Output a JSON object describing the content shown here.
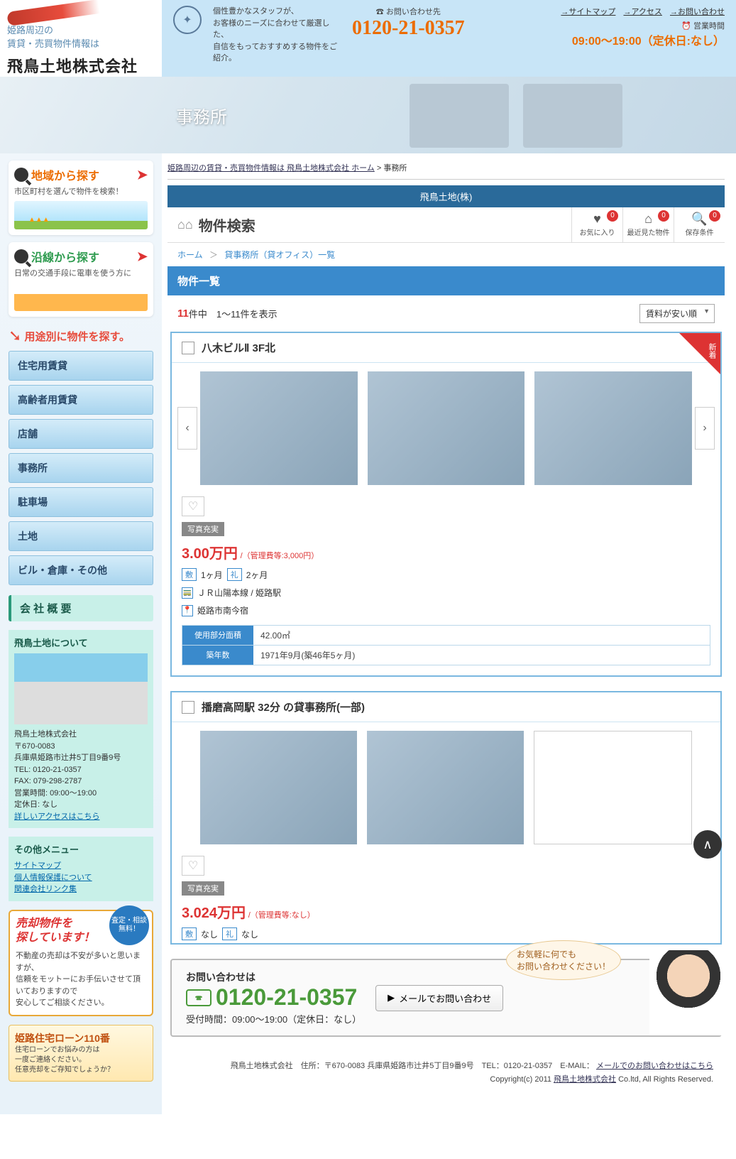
{
  "header": {
    "tagline1": "姫路周辺の",
    "tagline2": "賃貸・売買物件情報は",
    "company": "飛鳥土地株式会社",
    "msg": "個性豊かなスタッフが、\nお客様のニーズに合わせて厳選した、\n自信をもっておすすめする物件をご紹介。",
    "phone_label": "☎ お問い合わせ先",
    "phone": "0120-21-0357",
    "links": {
      "sitemap": "→サイトマップ",
      "access": "→アクセス",
      "contact": "→お問い合わせ"
    },
    "hours_label": "⏰ 営業時間",
    "hours": "09:00～19:00（定休日:なし）"
  },
  "hero": {
    "title": "事務所"
  },
  "sidebar": {
    "search_area": {
      "title": "地域から探す",
      "sub": "市区町村を選んで物件を検索！"
    },
    "search_line": {
      "title": "沿線から探す",
      "sub": "日常の交通手段に電車を使う方に"
    },
    "cat_heading": "用途別に物件を探す。",
    "categories": [
      "住宅用賃貸",
      "高齢者用賃貸",
      "店舗",
      "事務所",
      "駐車場",
      "土地",
      "ビル・倉庫・その他"
    ],
    "company_panel": "会 社 概 要",
    "about": {
      "title": "飛鳥土地について",
      "name": "飛鳥土地株式会社",
      "zip": "〒670-0083",
      "addr": "兵庫県姫路市辻井5丁目9番9号",
      "tel": "TEL: 0120-21-0357",
      "fax": "FAX: 079-298-2787",
      "hours": "営業時間: 09:00～19:00",
      "holiday": "定休日: なし",
      "access_link": "詳しいアクセスはこちら"
    },
    "other_menu": {
      "title": "その他メニュー",
      "items": [
        "サイトマップ",
        "個人情報保護について",
        "関連会社リンク集"
      ]
    },
    "sell_banner": {
      "badge": "査定・相談\n無料！",
      "title": "売却物件を\n探しています！",
      "body": "不動産の売却は不安が多いと思いますが、\n信頼をモットーにお手伝いさせて頂いておりますので\n安心してご相談ください。"
    },
    "loan_banner": {
      "title": "姫路住宅ローン110番",
      "body": "住宅ローンでお悩みの方は\n一度ご連絡ください。\n任意売却をご存知でしょうか？"
    }
  },
  "content": {
    "breadcrumb_global": {
      "link": "姫路周辺の賃貸・売買物件情報は 飛鳥土地株式会社 ホーム",
      "current": "事務所"
    },
    "app_header": "飛鳥土地(株)",
    "app_title": "物件検索",
    "toolbar": {
      "fav": "お気に入り",
      "recent": "最近見た物件",
      "saved": "保存条件",
      "fav_count": "0",
      "recent_count": "0",
      "saved_count": "0"
    },
    "breadcrumb_app": {
      "home": "ホーム",
      "current": "貸事務所（貸オフィス）一覧"
    },
    "section_title": "物件一覧",
    "result": {
      "count": "11",
      "range": "件中　1～11件を表示",
      "sort": "賃料が安い順"
    },
    "properties": [
      {
        "new": true,
        "title": "八木ビルⅡ 3F北",
        "tag": "写真充実",
        "price": "3.00万円",
        "price_sub": "/（管理費等:3,000円）",
        "shiki": "1ヶ月",
        "rei": "2ヶ月",
        "line": "ＪＲ山陽本線 / 姫路駅",
        "addr": "姫路市南今宿",
        "spec1_label": "使用部分面積",
        "spec1_val": "42.00㎡",
        "spec2_label": "築年数",
        "spec2_val": "1971年9月(築46年5ヶ月)"
      },
      {
        "new": false,
        "title": "播磨高岡駅 32分 の貸事務所(一部)",
        "tag": "写真充実",
        "price": "3.024万円",
        "price_sub": "/（管理費等:なし）",
        "shiki": "なし",
        "rei": "なし"
      }
    ],
    "labels": {
      "shiki": "敷",
      "rei": "礼",
      "arrow": "＞"
    },
    "contact": {
      "heading": "お問い合わせは",
      "phone": "0120-21-0357",
      "hours": "受付時間：09:00～19:00（定休日：なし）",
      "mail_btn": "メールでお問い合わせ",
      "bubble": "お気軽に何でも\nお問い合わせください！"
    }
  },
  "footer": {
    "line1_pre": "飛鳥土地株式会社　住所：〒670-0083 兵庫県姫路市辻井5丁目9番9号　TEL：0120-21-0357　E-MAIL：",
    "mail_link": "メールでのお問い合わせはこちら",
    "line2_pre": "Copyright(c) 2011 ",
    "line2_link": "飛鳥土地株式会社",
    "line2_post": " Co.ltd, All Rights Reserved."
  }
}
